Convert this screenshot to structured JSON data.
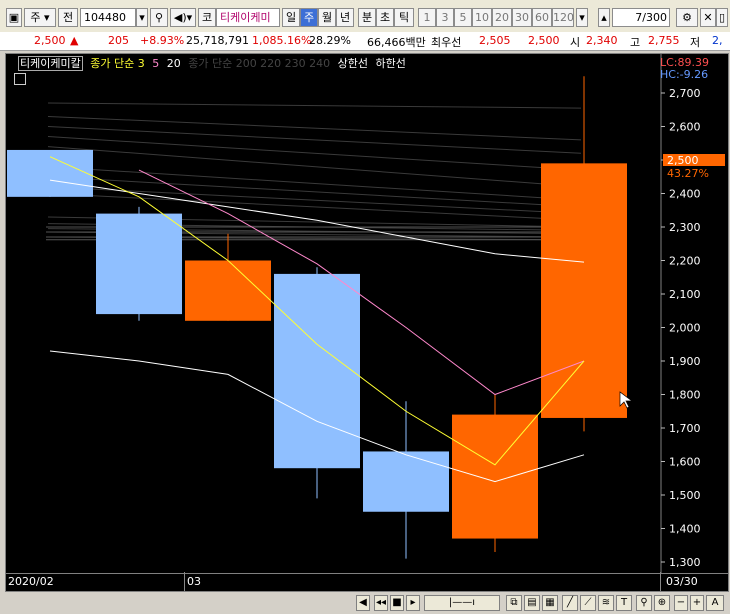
{
  "toolbar": {
    "market": "주",
    "prev_label": "전",
    "code": "104480",
    "kr_label": "코",
    "stock_name": "티케이케미",
    "periods": [
      "일",
      "주",
      "월",
      "년"
    ],
    "selected_period": "주",
    "intraday": [
      "분",
      "초",
      "틱"
    ],
    "minutes": [
      "1",
      "3",
      "5",
      "10",
      "20",
      "30",
      "60",
      "120"
    ],
    "page_value": "7",
    "page_total": "/300"
  },
  "quote": {
    "price": "2,500",
    "change": "205",
    "change_pct": "+8.93%",
    "volume": "25,718,791",
    "volume_ratio": "1,085.16%",
    "turnover": "28.29%",
    "amount": "66,466백만",
    "pref_label": "최우선",
    "ask": "2,505",
    "bid": "2,500",
    "open_label": "시",
    "open": "2,340",
    "high_label": "고",
    "high": "2,755",
    "low_label": "저",
    "low": "2,"
  },
  "legend": {
    "name": "티케이케미칼",
    "ma_label": "종가 단순 3",
    "ma_5": "5",
    "ma_20": "20",
    "ma_long": "종가 단순 200 220 230 240",
    "upper": "상한선",
    "lower": "하한선",
    "lc": "LC:89.39",
    "hc": "HC:-9.26"
  },
  "xaxis": {
    "left": "2020/02",
    "mid": "03",
    "right": "03/30"
  },
  "colors": {
    "up": "#ff6600",
    "down": "#8fbfff",
    "ma3": "#ffff33",
    "ma5": "#ff88cc",
    "ma20": "#ffffff"
  },
  "chart_data": {
    "type": "candlestick",
    "ylim": [
      1250,
      2800
    ],
    "yticks": [
      1300,
      1400,
      1500,
      1600,
      1700,
      1800,
      1900,
      2000,
      2100,
      2200,
      2300,
      2400,
      2500,
      2600,
      2700
    ],
    "current_price": "2,500",
    "current_pct": "43.27%",
    "candles": [
      {
        "open": 2530,
        "close": 2390,
        "high": 2530,
        "low": 2390
      },
      {
        "open": 2340,
        "close": 2040,
        "high": 2360,
        "low": 2020
      },
      {
        "open": 2020,
        "close": 2200,
        "high": 2280,
        "low": 2020
      },
      {
        "open": 2160,
        "close": 1580,
        "high": 2180,
        "low": 1490
      },
      {
        "open": 1630,
        "close": 1450,
        "high": 1780,
        "low": 1310
      },
      {
        "open": 1370,
        "close": 1740,
        "high": 1800,
        "low": 1330
      },
      {
        "open": 1730,
        "close": 2490,
        "high": 2750,
        "low": 1690
      }
    ],
    "ma3": [
      2510,
      2390,
      2200,
      1950,
      1750,
      1590,
      1900
    ],
    "ma5": [
      null,
      2470,
      2340,
      2190,
      2000,
      1800,
      1900
    ],
    "ma20": [
      1930,
      1900,
      1860,
      1720,
      1620,
      1540,
      1620
    ],
    "longma": [
      2440,
      2400,
      2360,
      2320,
      2270,
      2220,
      2195
    ]
  }
}
